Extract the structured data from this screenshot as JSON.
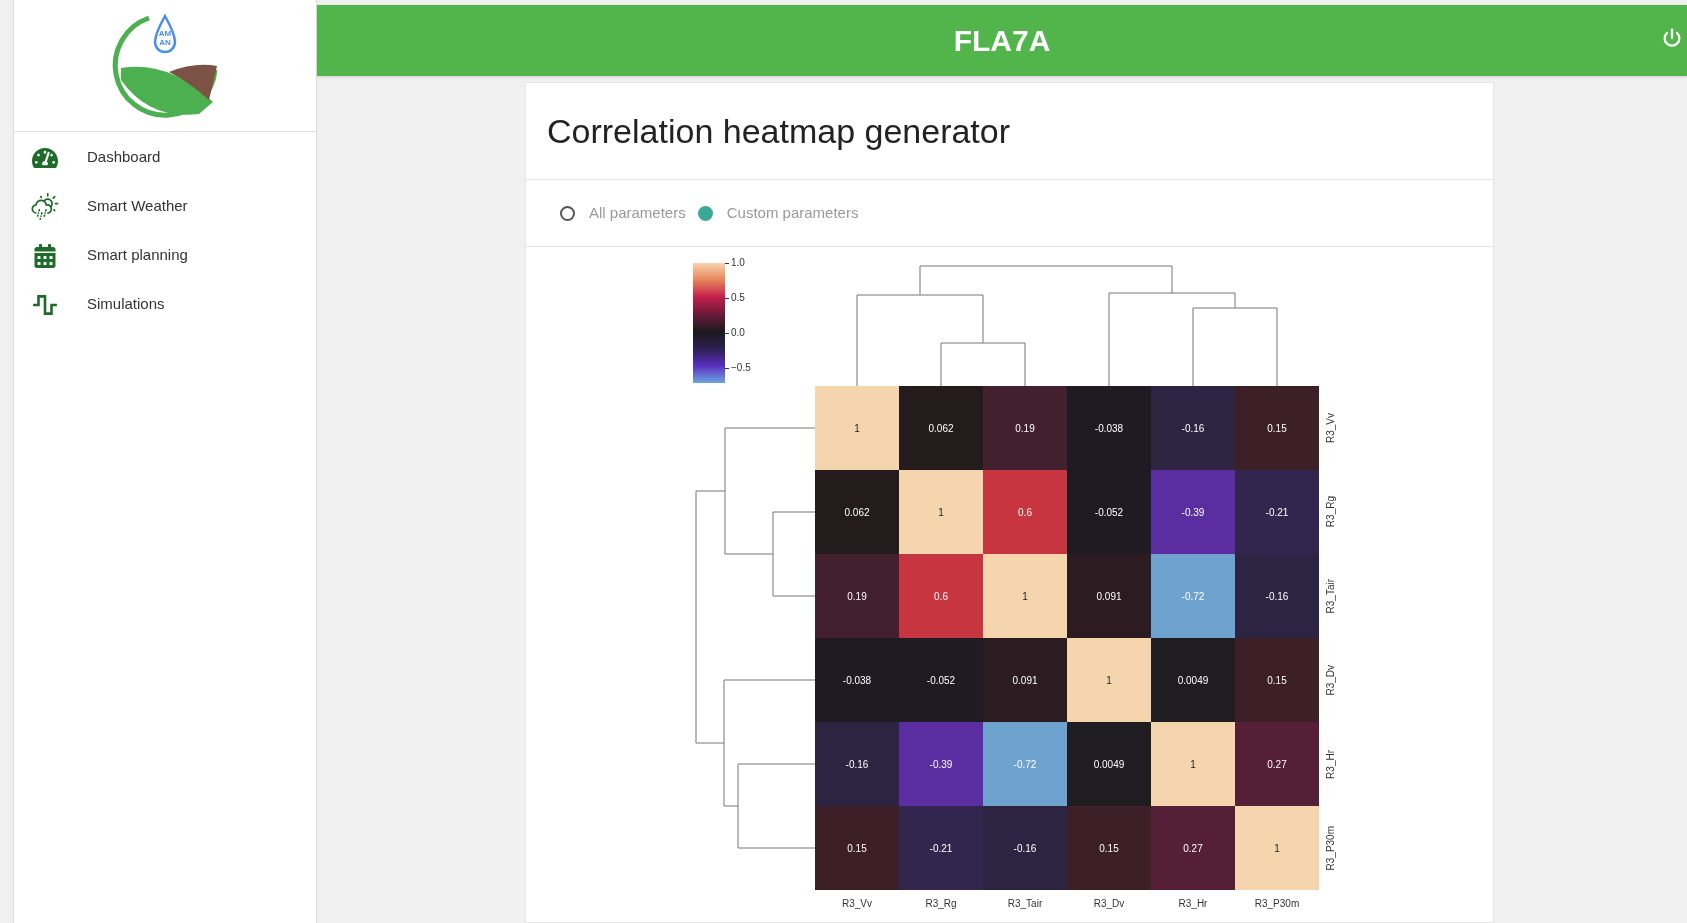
{
  "sidebar": {
    "logo": {
      "lines": [
        "AM",
        "AN"
      ]
    },
    "items": [
      {
        "label": "Dashboard"
      },
      {
        "label": "Smart Weather"
      },
      {
        "label": "Smart planning"
      },
      {
        "label": "Simulations"
      }
    ]
  },
  "header": {
    "title": "FLA7A"
  },
  "card": {
    "title": "Correlation heatmap generator",
    "options": [
      {
        "label": "All parameters",
        "selected": false
      },
      {
        "label": "Custom parameters",
        "selected": true
      }
    ],
    "heatmap": {
      "colorbar_ticks": [
        "1.0",
        "0.5",
        "0.0",
        "−0.5"
      ],
      "rows": [
        {
          "cells": [
            {
              "value": "1",
              "color": "#f5d5ae"
            },
            {
              "value": "0.062",
              "color": "#231b1c"
            },
            {
              "value": "0.19",
              "color": "#43202e"
            },
            {
              "value": "-0.038",
              "color": "#1e1c22"
            },
            {
              "value": "-0.16",
              "color": "#2c2440"
            },
            {
              "value": "0.15",
              "color": "#3d1f28"
            }
          ]
        },
        {
          "cells": [
            {
              "value": "0.062",
              "color": "#231b1c"
            },
            {
              "value": "1",
              "color": "#f5d5ae"
            },
            {
              "value": "0.6",
              "color": "#c73540"
            },
            {
              "value": "-0.052",
              "color": "#1e1c22"
            },
            {
              "value": "-0.39",
              "color": "#5a2ea0"
            },
            {
              "value": "-0.21",
              "color": "#32264e"
            }
          ]
        },
        {
          "cells": [
            {
              "value": "0.19",
              "color": "#43202e"
            },
            {
              "value": "0.6",
              "color": "#c73540"
            },
            {
              "value": "1",
              "color": "#f5d5ae"
            },
            {
              "value": "0.091",
              "color": "#2c1c22"
            },
            {
              "value": "-0.72",
              "color": "#6fa3cf"
            },
            {
              "value": "-0.16",
              "color": "#2c2440"
            }
          ]
        },
        {
          "cells": [
            {
              "value": "-0.038",
              "color": "#1e1c22"
            },
            {
              "value": "-0.052",
              "color": "#1e1c22"
            },
            {
              "value": "0.091",
              "color": "#2c1c22"
            },
            {
              "value": "1",
              "color": "#f5d5ae"
            },
            {
              "value": "0.0049",
              "color": "#1f1d1f"
            },
            {
              "value": "0.15",
              "color": "#3d1f28"
            }
          ]
        },
        {
          "cells": [
            {
              "value": "-0.16",
              "color": "#2c2440"
            },
            {
              "value": "-0.39",
              "color": "#5a2ea0"
            },
            {
              "value": "-0.72",
              "color": "#6fa3cf"
            },
            {
              "value": "0.0049",
              "color": "#1f1d1f"
            },
            {
              "value": "1",
              "color": "#f5d5ae"
            },
            {
              "value": "0.27",
              "color": "#561f38"
            }
          ]
        },
        {
          "cells": [
            {
              "value": "0.15",
              "color": "#3d1f28"
            },
            {
              "value": "-0.21",
              "color": "#32264e"
            },
            {
              "value": "-0.16",
              "color": "#2c2440"
            },
            {
              "value": "0.15",
              "color": "#3d1f28"
            },
            {
              "value": "0.27",
              "color": "#561f38"
            },
            {
              "value": "1",
              "color": "#f5d5ae"
            }
          ]
        }
      ],
      "row_labels": [
        "R3_Vv",
        "R3_Rg",
        "R3_Tair",
        "R3_Dv",
        "R3_Hr",
        "R3_P30m"
      ],
      "column_labels": [
        "R3_Vv",
        "R3_Rg",
        "R3_Tair",
        "R3_Dv",
        "R3_Hr",
        "R3_P30m"
      ]
    }
  }
}
